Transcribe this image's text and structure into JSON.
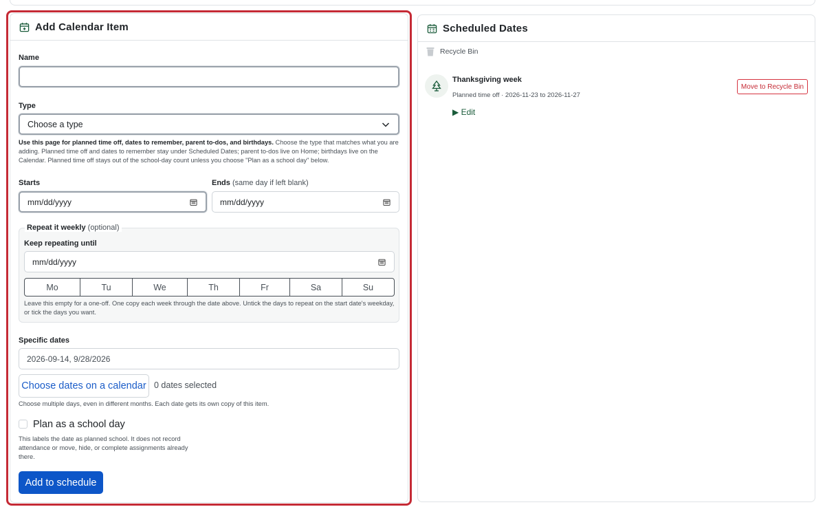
{
  "add_card": {
    "title": "Add Calendar Item",
    "name_label": "Name",
    "name_value": "",
    "type_label": "Type",
    "type_selected": "Choose a type",
    "type_help_bold": "Use this page for planned time off, dates to remember, parent to-dos, and birthdays.",
    "type_help_rest": " Choose the type that matches what you are adding. Planned time off and dates to remember stay under Scheduled Dates; parent to-dos live on Home; birthdays live on the Calendar. Planned time off stays out of the school-day count unless you choose \"Plan as a school day\" below.",
    "starts_label": "Starts",
    "starts_placeholder": "mm/dd/yyyy",
    "ends_label": "Ends",
    "ends_hint": "(same day if left blank)",
    "ends_placeholder": "mm/dd/yyyy",
    "repeat": {
      "legend": "Repeat it weekly",
      "legend_hint": "(optional)",
      "until_label": "Keep repeating until",
      "until_placeholder": "mm/dd/yyyy",
      "days": [
        "Mo",
        "Tu",
        "We",
        "Th",
        "Fr",
        "Sa",
        "Su"
      ],
      "help": "Leave this empty for a one-off. One copy each week through the date above. Untick the days to repeat on the start date's weekday, or tick the days you want."
    },
    "specific_label": "Specific dates",
    "specific_value": "2026-09-14, 9/28/2026",
    "choose_dates_button": "Choose dates on a calendar",
    "dates_selected": "0 dates selected",
    "specific_help": "Choose multiple days, even in different months. Each date gets its own copy of this item.",
    "school_day_label": "Plan as a school day",
    "school_day_help": "This labels the date as planned school. It does not record attendance or move, hide, or complete assignments already there.",
    "submit_button": "Add to schedule"
  },
  "sched_card": {
    "title": "Scheduled Dates",
    "recycle_bin": "Recycle Bin",
    "items": [
      {
        "title": "Thanksgiving week",
        "meta": "Planned time off · 2026-11-23 to 2026-11-27",
        "edit": "▶ Edit",
        "action": "Move to Recycle Bin"
      }
    ]
  },
  "colors": {
    "accent": "#1a5b3a",
    "primary": "#0d56c8",
    "danger": "#c52a35",
    "highlight_outline": "#c52a35"
  }
}
